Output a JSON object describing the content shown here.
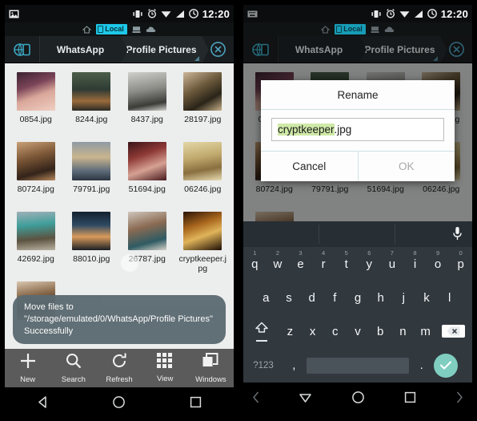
{
  "status_bar": {
    "icons": [
      "gallery-icon",
      "vibrate-icon",
      "alarm-icon",
      "wifi-icon",
      "signal-icon",
      "battery-icon"
    ],
    "time": "12:20"
  },
  "location_row": {
    "home_icon": "home-icon",
    "chip_label": "Local",
    "chip_color": "#1ec8e8",
    "server_icon": "server-icon",
    "cloud_icon": "cloud-icon"
  },
  "breadcrumb": {
    "app_icon": "app-switch-icon",
    "items": [
      "WhatsApp",
      "Profile Pictures"
    ],
    "close_icon": "close-icon"
  },
  "files": [
    {
      "name": "0854.jpg"
    },
    {
      "name": "8244.jpg"
    },
    {
      "name": "8437.jpg"
    },
    {
      "name": "28197.jpg"
    },
    {
      "name": "80724.jpg"
    },
    {
      "name": "79791.jpg"
    },
    {
      "name": "51694.jpg"
    },
    {
      "name": "06246.jpg"
    },
    {
      "name": "42692.jpg"
    },
    {
      "name": "88010.jpg"
    },
    {
      "name": "26787.jpg"
    },
    {
      "name": "cryptkeeper.jpg"
    }
  ],
  "toast": {
    "message": "Move files to \"/storage/emulated/0/WhatsApp/Profile Pictures\" Successfully"
  },
  "toolbar": {
    "items": [
      {
        "label": "New",
        "icon": "plus-icon"
      },
      {
        "label": "Search",
        "icon": "search-icon"
      },
      {
        "label": "Refresh",
        "icon": "refresh-icon"
      },
      {
        "label": "View",
        "icon": "grid-view-icon"
      },
      {
        "label": "Windows",
        "icon": "windows-icon"
      }
    ]
  },
  "nav_bar": {
    "back_icon": "back-triangle-icon",
    "home_icon": "home-circle-icon",
    "recents_icon": "recents-square-icon"
  },
  "nav_bar_keyboard": {
    "left_chevron": "chevron-left-icon",
    "dismiss_icon": "keyboard-dismiss-icon",
    "home_icon": "home-circle-icon",
    "recents_icon": "recents-square-icon",
    "right_chevron": "chevron-right-icon"
  },
  "dialog": {
    "title": "Rename",
    "input_selected_text": "cryptkeeper",
    "input_tail_text": ".jpg",
    "input_full_value": "cryptkeeper.jpg",
    "selection_color": "#cfe9a8",
    "cancel_label": "Cancel",
    "ok_label": "OK",
    "ok_enabled": false
  },
  "keyboard": {
    "suggestions": [
      "",
      "",
      ""
    ],
    "mic_icon": "microphone-icon",
    "row1": [
      {
        "key": "q",
        "num": "1"
      },
      {
        "key": "w",
        "num": "2"
      },
      {
        "key": "e",
        "num": "3"
      },
      {
        "key": "r",
        "num": "4"
      },
      {
        "key": "t",
        "num": "5"
      },
      {
        "key": "y",
        "num": "6"
      },
      {
        "key": "u",
        "num": "7"
      },
      {
        "key": "i",
        "num": "8"
      },
      {
        "key": "o",
        "num": "9"
      },
      {
        "key": "p",
        "num": "0"
      }
    ],
    "row2": [
      "a",
      "s",
      "d",
      "f",
      "g",
      "h",
      "j",
      "k",
      "l"
    ],
    "row3": [
      "z",
      "x",
      "c",
      "v",
      "b",
      "n",
      "m"
    ],
    "shift_icon": "shift-icon",
    "backspace_icon": "backspace-icon",
    "symbols_label": "?123",
    "comma_label": ",",
    "period_label": ".",
    "space_label": "",
    "enter_icon": "check-icon",
    "enter_color": "#7fcec0"
  }
}
